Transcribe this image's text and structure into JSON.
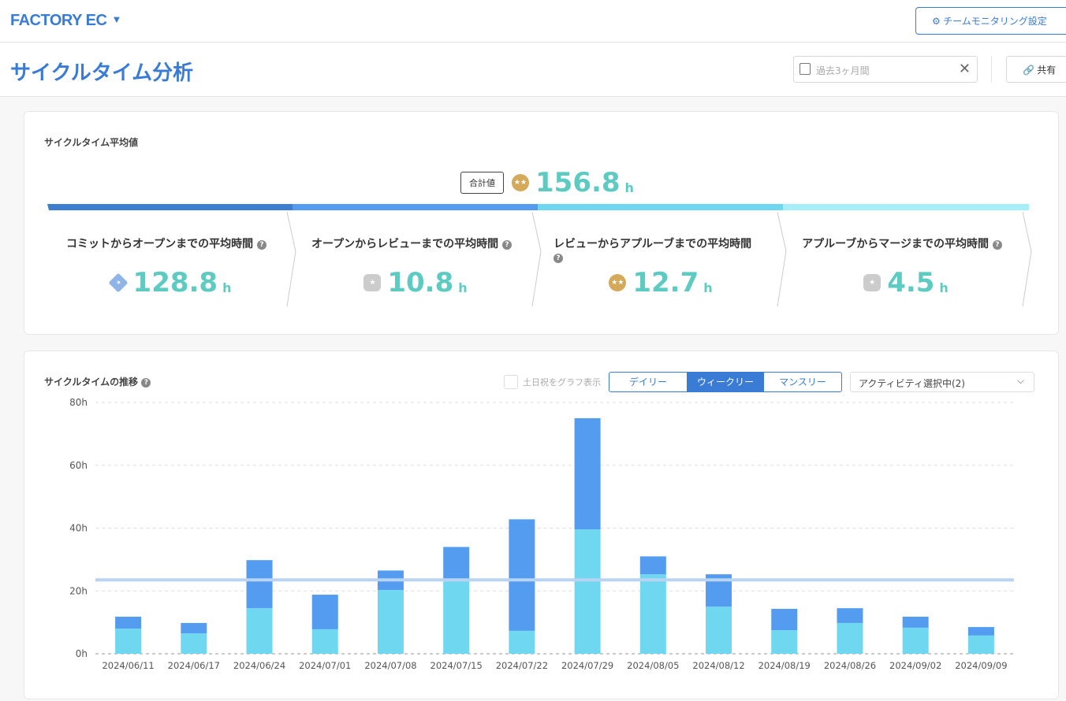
{
  "header": {
    "brand": "FACTORY EC",
    "team_button": "⚙ チームモニタリング設定"
  },
  "page": {
    "title": "サイクルタイム分析",
    "date_placeholder": "過去3ヶ月間",
    "share_label": "🔗 共有"
  },
  "summary": {
    "title": "サイクルタイム平均値",
    "total_label": "合計値",
    "total_value": "156.8",
    "unit": "h",
    "stages": [
      {
        "label": "コミットからオープンまでの平均時間",
        "value": "128.8",
        "color": "#3d7ed0",
        "icon": "diamond-star-icon"
      },
      {
        "label": "オープンからレビューまでの平均時間",
        "value": "10.8",
        "color": "#549cf0",
        "icon": "hexagon-stars-icon"
      },
      {
        "label": "レビューからアプルーブまでの平均時間",
        "value": "12.7",
        "color": "#6fd7f0",
        "icon": "gold-medal-icon"
      },
      {
        "label": "アプルーブからマージまでの平均時間",
        "value": "4.5",
        "color": "#a6eefa",
        "icon": "hexagon-stars-icon"
      }
    ]
  },
  "trend": {
    "title": "サイクルタイムの推移",
    "weekend_label": "土日祝をグラフ表示",
    "tabs": [
      "デイリー",
      "ウィークリー",
      "マンスリー"
    ],
    "active_tab": "ウィークリー",
    "activity_select": "アクティビティ選択中(2)"
  },
  "chart_data": {
    "type": "bar",
    "stacked": true,
    "ylim": [
      0,
      80
    ],
    "yticks": [
      "0h",
      "20h",
      "40h",
      "60h",
      "80h"
    ],
    "grid": true,
    "categories": [
      "2024/06/11",
      "2024/06/17",
      "2024/06/24",
      "2024/07/01",
      "2024/07/08",
      "2024/07/15",
      "2024/07/22",
      "2024/07/29",
      "2024/08/05",
      "2024/08/12",
      "2024/08/19",
      "2024/08/26",
      "2024/09/02",
      "2024/09/09"
    ],
    "series": [
      {
        "color": "#6fd7f0",
        "values": [
          8.0,
          6.5,
          14.5,
          7.8,
          20.3,
          23.3,
          7.3,
          39.6,
          25.3,
          15.0,
          7.5,
          9.8,
          8.3,
          5.8
        ]
      },
      {
        "color": "#549cf0",
        "values": [
          3.8,
          3.3,
          15.3,
          11.0,
          6.2,
          10.7,
          35.5,
          35.4,
          5.7,
          10.3,
          6.8,
          4.7,
          3.5,
          2.7
        ]
      }
    ],
    "average_line": 23.5,
    "average_color": "#b9d3f2"
  }
}
